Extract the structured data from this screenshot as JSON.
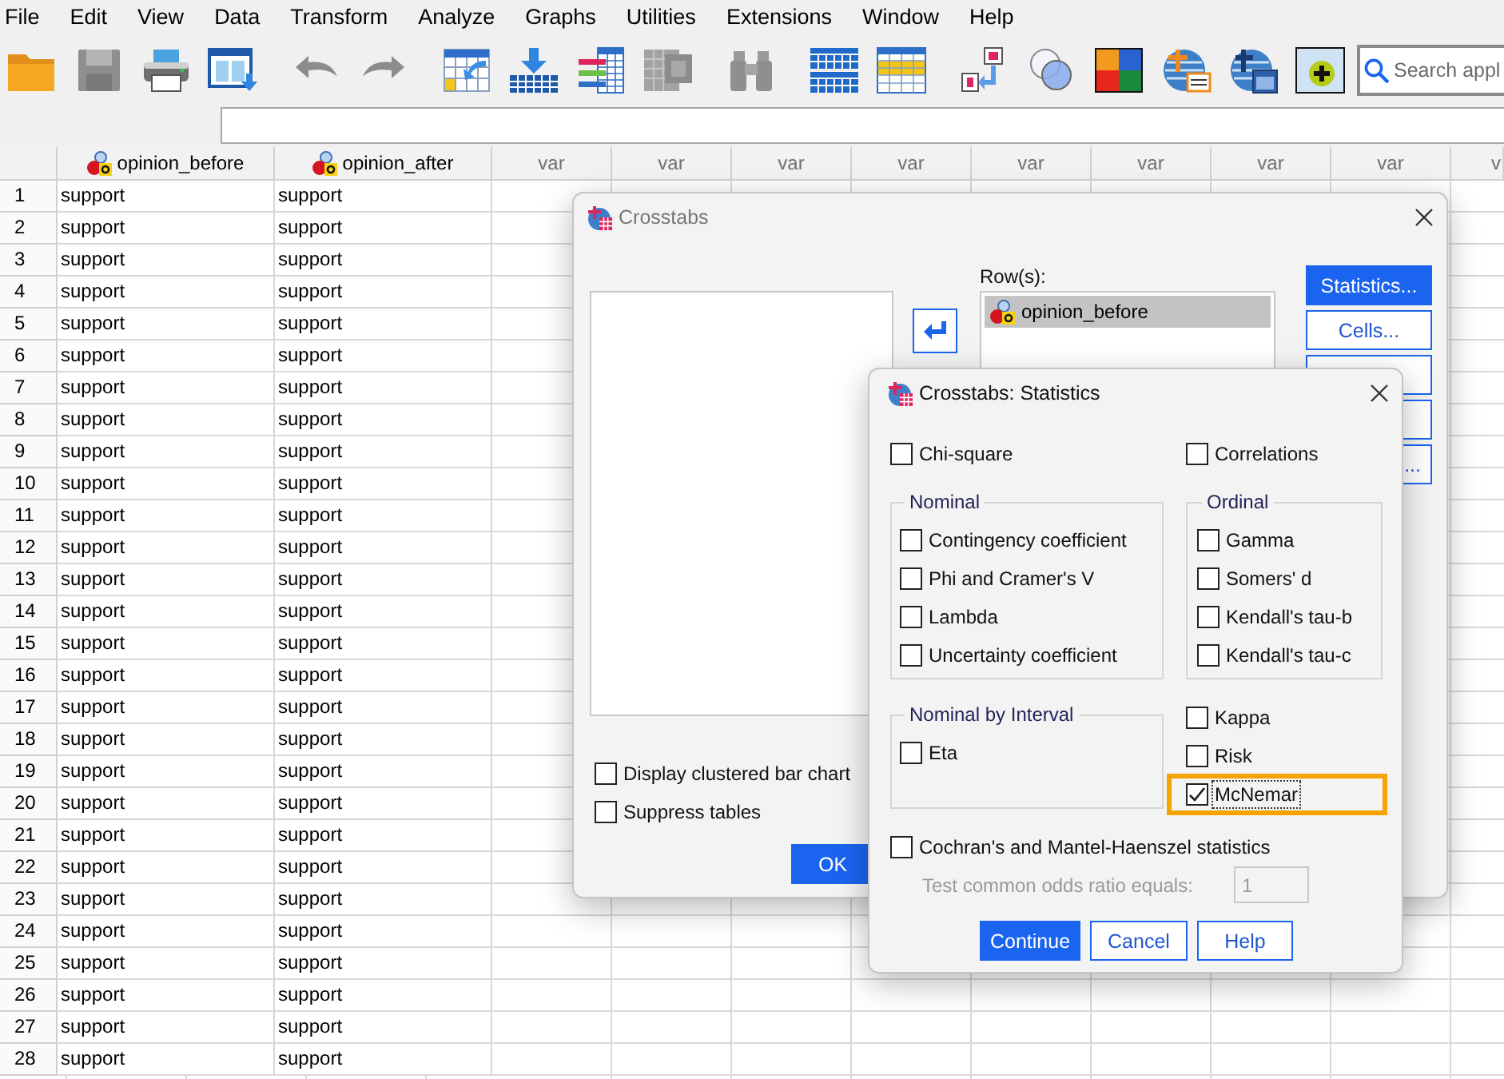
{
  "menu_bar": {
    "items": [
      "File",
      "Edit",
      "View",
      "Data",
      "Transform",
      "Analyze",
      "Graphs",
      "Utilities",
      "Extensions",
      "Window",
      "Help"
    ]
  },
  "toolbar": {
    "groups": [
      [
        {
          "kind": "open",
          "disabled": false
        },
        {
          "kind": "save",
          "disabled": true
        },
        {
          "kind": "print",
          "disabled": false
        },
        {
          "kind": "recall",
          "disabled": false
        }
      ],
      [
        {
          "kind": "undo",
          "disabled": true
        },
        {
          "kind": "redo",
          "disabled": true
        }
      ],
      [
        {
          "kind": "goto_case",
          "disabled": false
        },
        {
          "kind": "goto_variable",
          "disabled": false
        },
        {
          "kind": "variables",
          "disabled": false
        },
        {
          "kind": "descriptives",
          "disabled": true
        }
      ],
      [
        {
          "kind": "find",
          "disabled": true
        }
      ],
      [
        {
          "kind": "split",
          "disabled": false
        },
        {
          "kind": "select",
          "disabled": false
        }
      ],
      [
        {
          "kind": "value_labels",
          "disabled": false
        },
        {
          "kind": "sets",
          "disabled": false
        },
        {
          "kind": "squares",
          "disabled": false
        },
        {
          "kind": "globe_plus",
          "disabled": false
        },
        {
          "kind": "globe_window",
          "disabled": false
        },
        {
          "kind": "plus",
          "disabled": false
        }
      ]
    ],
    "search": {
      "placeholder": "Search appl"
    }
  },
  "data_grid": {
    "columns": [
      {
        "name": "opinion_before",
        "kind": "variable"
      },
      {
        "name": "opinion_after",
        "kind": "variable"
      },
      {
        "name": "var",
        "kind": "placeholder"
      },
      {
        "name": "var",
        "kind": "placeholder"
      },
      {
        "name": "var",
        "kind": "placeholder"
      },
      {
        "name": "var",
        "kind": "placeholder"
      },
      {
        "name": "var",
        "kind": "placeholder"
      },
      {
        "name": "var",
        "kind": "placeholder"
      },
      {
        "name": "var",
        "kind": "placeholder"
      },
      {
        "name": "var",
        "kind": "placeholder"
      },
      {
        "name": "v",
        "kind": "clipped"
      }
    ],
    "rows": [
      {
        "number": "1",
        "cells": [
          "support",
          "support"
        ]
      },
      {
        "number": "2",
        "cells": [
          "support",
          "support"
        ]
      },
      {
        "number": "3",
        "cells": [
          "support",
          "support"
        ]
      },
      {
        "number": "4",
        "cells": [
          "support",
          "support"
        ]
      },
      {
        "number": "5",
        "cells": [
          "support",
          "support"
        ]
      },
      {
        "number": "6",
        "cells": [
          "support",
          "support"
        ]
      },
      {
        "number": "7",
        "cells": [
          "support",
          "support"
        ]
      },
      {
        "number": "8",
        "cells": [
          "support",
          "support"
        ]
      },
      {
        "number": "9",
        "cells": [
          "support",
          "support"
        ]
      },
      {
        "number": "10",
        "cells": [
          "support",
          "support"
        ]
      },
      {
        "number": "11",
        "cells": [
          "support",
          "support"
        ]
      },
      {
        "number": "12",
        "cells": [
          "support",
          "support"
        ]
      },
      {
        "number": "13",
        "cells": [
          "support",
          "support"
        ]
      },
      {
        "number": "14",
        "cells": [
          "support",
          "support"
        ]
      },
      {
        "number": "15",
        "cells": [
          "support",
          "support"
        ]
      },
      {
        "number": "16",
        "cells": [
          "support",
          "support"
        ]
      },
      {
        "number": "17",
        "cells": [
          "support",
          "support"
        ]
      },
      {
        "number": "18",
        "cells": [
          "support",
          "support"
        ]
      },
      {
        "number": "19",
        "cells": [
          "support",
          "support"
        ]
      },
      {
        "number": "20",
        "cells": [
          "support",
          "support"
        ]
      },
      {
        "number": "21",
        "cells": [
          "support",
          "support"
        ]
      },
      {
        "number": "22",
        "cells": [
          "support",
          "support"
        ]
      },
      {
        "number": "23",
        "cells": [
          "support",
          "support"
        ]
      },
      {
        "number": "24",
        "cells": [
          "support",
          "support"
        ]
      },
      {
        "number": "25",
        "cells": [
          "support",
          "support"
        ]
      },
      {
        "number": "26",
        "cells": [
          "support",
          "support"
        ]
      },
      {
        "number": "27",
        "cells": [
          "support",
          "support"
        ]
      },
      {
        "number": "28",
        "cells": [
          "support",
          "support"
        ]
      }
    ]
  },
  "crosstabs_dialog": {
    "title": "Crosstabs",
    "active": false,
    "rows_label": "Row(s):",
    "rows_items": [
      {
        "name": "opinion_before",
        "selected": true
      }
    ],
    "buttons": [
      {
        "label": "Statistics...",
        "default": true,
        "covered": false
      },
      {
        "label": "Cells...",
        "default": false,
        "covered": false
      },
      {
        "default": false
      },
      {
        "default": false
      },
      {
        "label": "...",
        "default": false,
        "covered": true
      }
    ],
    "options": [
      {
        "label": "Display clustered bar chart",
        "checked": false
      },
      {
        "label": "Suppress tables",
        "checked": false
      }
    ],
    "ok_button": {
      "label": "OK",
      "default": true
    }
  },
  "statistics_dialog": {
    "title": "Crosstabs: Statistics",
    "active": true,
    "chi_square": {
      "label": "Chi-square",
      "checked": false
    },
    "correlations": {
      "label": "Correlations",
      "checked": false
    },
    "nominal": {
      "title": "Nominal",
      "items": [
        {
          "label": "Contingency coefficient",
          "checked": false
        },
        {
          "label": "Phi and Cramer's V",
          "checked": false
        },
        {
          "label": "Lambda",
          "checked": false
        },
        {
          "label": "Uncertainty coefficient",
          "checked": false
        }
      ]
    },
    "ordinal": {
      "title": "Ordinal",
      "items": [
        {
          "label": "Gamma",
          "checked": false
        },
        {
          "label": "Somers' d",
          "checked": false
        },
        {
          "label": "Kendall's tau-b",
          "checked": false
        },
        {
          "label": "Kendall's tau-c",
          "checked": false
        }
      ]
    },
    "nominal_by_interval": {
      "title": "Nominal by Interval",
      "items": [
        {
          "label": "Eta",
          "checked": false
        }
      ]
    },
    "other": [
      {
        "label": "Kappa",
        "checked": false,
        "highlighted": false
      },
      {
        "label": "Risk",
        "checked": false,
        "highlighted": false
      },
      {
        "label": "McNemar",
        "checked": true,
        "highlighted": true
      }
    ],
    "cochran": {
      "label": "Cochran's and Mantel-Haenszel statistics",
      "checked": false
    },
    "odds_ratio": {
      "label": "Test common odds ratio equals:",
      "value": "1",
      "disabled": true
    },
    "buttons": [
      {
        "label": "Continue",
        "default": true
      },
      {
        "label": "Cancel",
        "default": false
      },
      {
        "label": "Help",
        "default": false
      }
    ]
  }
}
